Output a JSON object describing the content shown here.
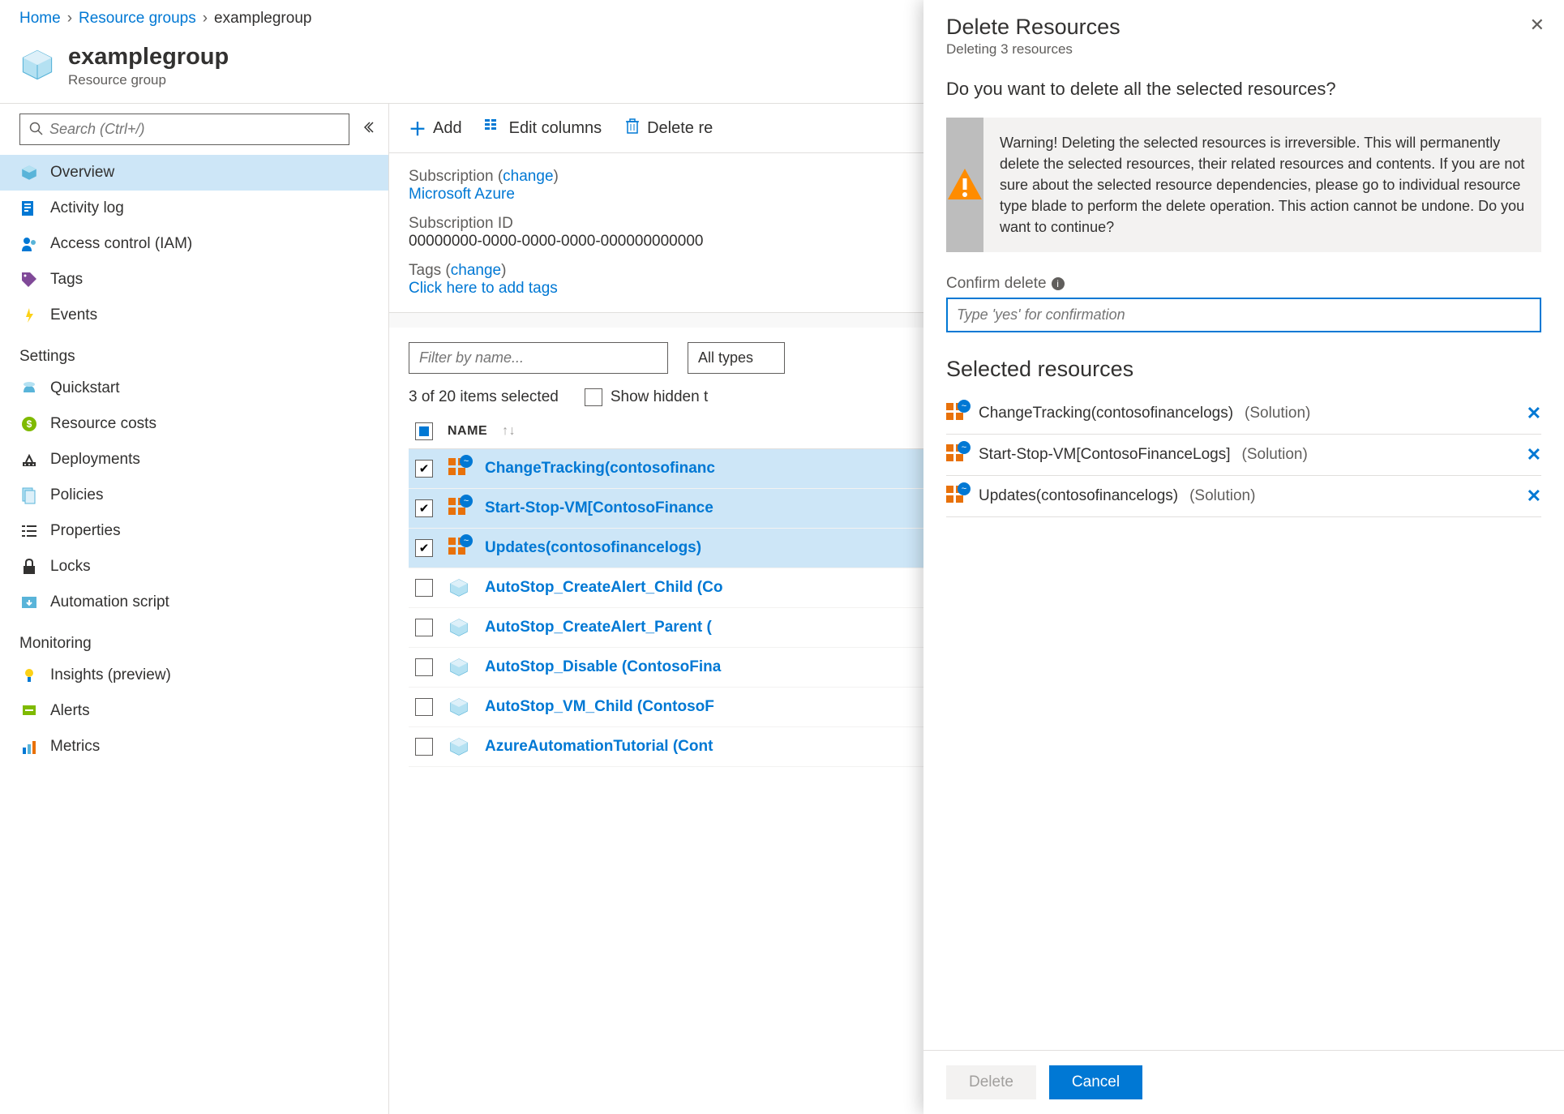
{
  "breadcrumb": {
    "home": "Home",
    "resource_groups": "Resource groups",
    "current": "examplegroup"
  },
  "header": {
    "title": "examplegroup",
    "subtitle": "Resource group"
  },
  "sidebar": {
    "search_placeholder": "Search (Ctrl+/)",
    "items_top": [
      {
        "label": "Overview",
        "active": true
      },
      {
        "label": "Activity log"
      },
      {
        "label": "Access control (IAM)"
      },
      {
        "label": "Tags"
      },
      {
        "label": "Events"
      }
    ],
    "section_settings": "Settings",
    "items_settings": [
      {
        "label": "Quickstart"
      },
      {
        "label": "Resource costs"
      },
      {
        "label": "Deployments"
      },
      {
        "label": "Policies"
      },
      {
        "label": "Properties"
      },
      {
        "label": "Locks"
      },
      {
        "label": "Automation script"
      }
    ],
    "section_monitoring": "Monitoring",
    "items_monitoring": [
      {
        "label": "Insights (preview)"
      },
      {
        "label": "Alerts"
      },
      {
        "label": "Metrics"
      }
    ]
  },
  "toolbar": {
    "add": "Add",
    "edit_columns": "Edit columns",
    "delete": "Delete re"
  },
  "info": {
    "subscription_label": "Subscription",
    "change": "change",
    "subscription_value": "Microsoft Azure",
    "subscription_id_label": "Subscription ID",
    "subscription_id_value": "00000000-0000-0000-0000-000000000000",
    "tags_label": "Tags",
    "tags_link": "Click here to add tags"
  },
  "list": {
    "filter_placeholder": "Filter by name...",
    "all_types": "All types",
    "selection_text": "3 of 20 items selected",
    "show_hidden": "Show hidden t",
    "name_header": "NAME",
    "rows": [
      {
        "name": "ChangeTracking(contosofinanc",
        "selected": true,
        "type": "solution"
      },
      {
        "name": "Start-Stop-VM[ContosoFinance",
        "selected": true,
        "type": "solution"
      },
      {
        "name": "Updates(contosofinancelogs)",
        "selected": true,
        "type": "solution"
      },
      {
        "name": "AutoStop_CreateAlert_Child (Co",
        "selected": false,
        "type": "runbook"
      },
      {
        "name": "AutoStop_CreateAlert_Parent (",
        "selected": false,
        "type": "runbook"
      },
      {
        "name": "AutoStop_Disable (ContosoFina",
        "selected": false,
        "type": "runbook"
      },
      {
        "name": "AutoStop_VM_Child (ContosoF",
        "selected": false,
        "type": "runbook"
      },
      {
        "name": "AzureAutomationTutorial (Cont",
        "selected": false,
        "type": "runbook"
      }
    ]
  },
  "panel": {
    "title": "Delete Resources",
    "subtitle": "Deleting 3 resources",
    "question": "Do you want to delete all the selected resources?",
    "warning": "Warning! Deleting the selected resources is irreversible. This will permanently delete the selected resources, their related resources and contents. If you are not sure about the selected resource dependencies, please go to individual resource type blade to perform the delete operation. This action cannot be undone. Do you want to continue?",
    "confirm_label": "Confirm delete",
    "confirm_placeholder": "Type 'yes' for confirmation",
    "selected_heading": "Selected resources",
    "selected": [
      {
        "name": "ChangeTracking(contosofinancelogs)",
        "type": "(Solution)"
      },
      {
        "name": "Start-Stop-VM[ContosoFinanceLogs]",
        "type": "(Solution)"
      },
      {
        "name": "Updates(contosofinancelogs)",
        "type": "(Solution)"
      }
    ],
    "delete_btn": "Delete",
    "cancel_btn": "Cancel"
  }
}
